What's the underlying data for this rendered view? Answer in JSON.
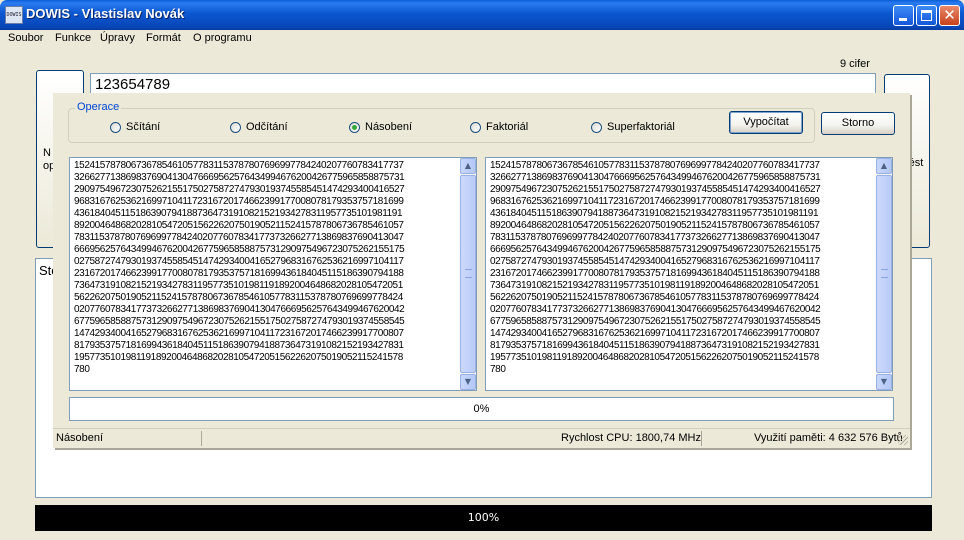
{
  "window": {
    "icon_text": "DOWIS",
    "title": "DOWIS - Vlastislav Novák"
  },
  "menu": [
    "Soubor",
    "Funkce",
    "Úpravy",
    "Formát",
    "O programu"
  ],
  "main": {
    "digits_label": "9 cifer",
    "input_value": "123654789",
    "left_button_text": "N\nop",
    "right_button_text": "rést",
    "log_text": "Sto",
    "progress_text": "100%",
    "progress_value": 1.0
  },
  "dialog": {
    "group_title": "Operace",
    "operations": [
      {
        "label": "Sčítání",
        "checked": false
      },
      {
        "label": "Odčítání",
        "checked": false
      },
      {
        "label": "Násobení",
        "checked": true
      },
      {
        "label": "Faktoriál",
        "checked": false
      },
      {
        "label": "Superfaktoriál",
        "checked": false
      }
    ],
    "calculate_label": "Vypočítat",
    "cancel_label": "Storno",
    "left_result": "1524157878067367854610577831153787807696997784240207760783417737\n3266277138698376904130476669562576434994676200426775965858875731\n2909754967230752621551750275872747930193745585451474293400416527\n9683167625362169971041172316720174662399177008078179353757181699\n4361840451151863907941887364731910821521934278311957735101981191\n8920046486820281054720515622620750190521152415787806736785461057\n7831153787807696997784240207760783417737326627713869837690413047\n6669562576434994676200426775965858875731290975496723075262155175\n0275872747930193745585451474293400416527968316762536216997104117\n2316720174662399177008078179353757181699436184045115186390794188\n7364731910821521934278311957735101981191892004648682028105472051\n5622620750190521152415787806736785461057783115378780769699778424\n0207760783417737326627713869837690413047666956257643499467620042\n6775965858875731290975496723075262155175027587274793019374558545\n1474293400416527968316762536216997104117231672017466239917700807\n8179353757181699436184045115186390794188736473191082152193427831\n1957735101981191892004648682028105472051562262075019052115241578\n780",
    "right_result": "1524157878067367854610577831153787807696997784240207760783417737\n3266277138698376904130476669562576434994676200426775965858875731\n2909754967230752621551750275872747930193745585451474293400416527\n9683167625362169971041172316720174662399177008078179353757181699\n4361840451151863907941887364731910821521934278311957735101981191\n8920046486820281054720515622620750190521152415787806736785461057\n7831153787807696997784240207760783417737326627713869837690413047\n6669562576434994676200426775965858875731290975496723075262155175\n0275872747930193745585451474293400416527968316762536216997104117\n2316720174662399177008078179353757181699436184045115186390794188\n7364731910821521934278311957735101981191892004648682028105472051\n5622620750190521152415787806736785461057783115378780769699778424\n0207760783417737326627713869837690413047666956257643499467620042\n6775965858875731290975496723075262155175027587274793019374558545\n1474293400416527968316762536216997104117231672017466239917700807\n8179353757181699436184045115186390794188736473191082152193427831\n1957735101981191892004648682028105472051562262075019052115241578\n780",
    "progress_text": "0%",
    "progress_value": 0.0
  },
  "status": {
    "operation": "Násobení",
    "cpu_speed": "Rychlost CPU: 1800,74 MHz",
    "memory": "Využití paměti: 4 632 576 Bytů"
  }
}
